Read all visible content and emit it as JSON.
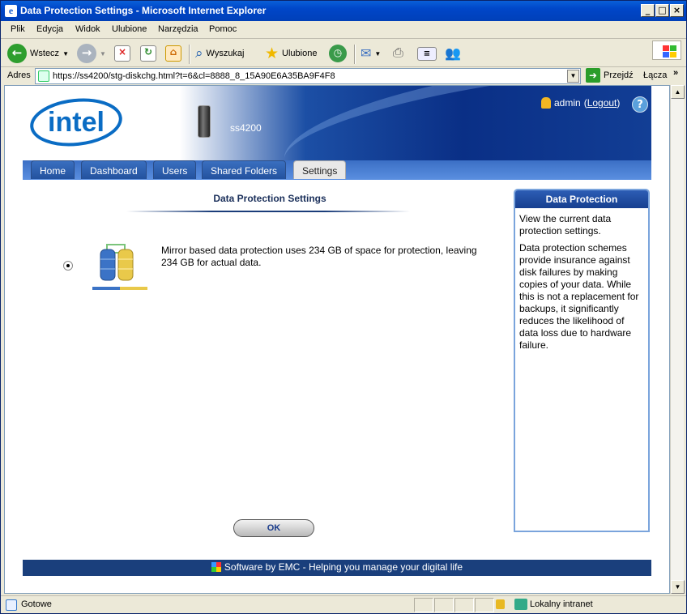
{
  "window": {
    "title": "Data Protection Settings - Microsoft Internet Explorer"
  },
  "menu": [
    "Plik",
    "Edycja",
    "Widok",
    "Ulubione",
    "Narzędzia",
    "Pomoc"
  ],
  "toolbar": {
    "back_label": "Wstecz",
    "search_label": "Wyszukaj",
    "favorites_label": "Ulubione"
  },
  "address": {
    "label": "Adres",
    "url": "https://ss4200/stg-diskchg.html?t=6&cl=8888_8_15A90E6A35BA9F4F8",
    "go_label": "Przejdź",
    "links_label": "Łącza"
  },
  "header": {
    "device_name": "ss4200",
    "user": "admin",
    "logout_label": "Logout",
    "logo_text": "intel"
  },
  "tabs": [
    {
      "label": "Home"
    },
    {
      "label": "Dashboard"
    },
    {
      "label": "Users"
    },
    {
      "label": "Shared Folders"
    },
    {
      "label": "Settings"
    }
  ],
  "main": {
    "title": "Data Protection Settings",
    "description": "Mirror based data protection uses 234 GB of space for protection, leaving 234 GB for actual data.",
    "ok_label": "OK",
    "radio_selected": true
  },
  "side_panel": {
    "title": "Data Protection",
    "para1": "View the current data protection settings.",
    "para2": "Data protection schemes provide insurance against disk failures by making copies of your data. While this is not a replacement for backups, it significantly reduces the likelihood of data loss due to hardware failure."
  },
  "footer": {
    "text": "Software by EMC - Helping you manage your digital life"
  },
  "status": {
    "text": "Gotowe",
    "zone": "Lokalny intranet"
  },
  "colors": {
    "titlebar": "#0046c8",
    "header_blue": "#0a2f86",
    "footer": "#1a3f7c",
    "panel_header": "#2d5db5"
  }
}
